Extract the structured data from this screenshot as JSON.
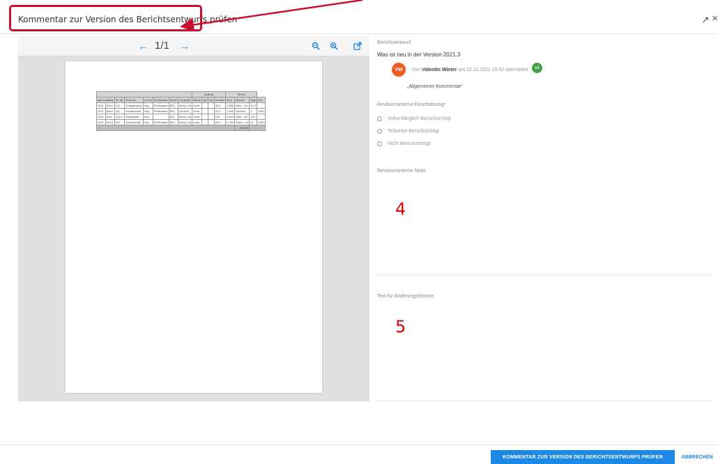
{
  "dialog": {
    "title": "Kommentar zur Version des Berichtsentwurfs prüfen",
    "expand_icon": "↗",
    "close_icon": "×"
  },
  "annotation": {
    "color": "#c8102e"
  },
  "viewer": {
    "prev_icon": "←",
    "next_icon": "→",
    "page_indicator": "1/1",
    "zoom_out_icon": "zoom-out",
    "zoom_in_icon": "zoom-in",
    "open_external_icon": "open-external"
  },
  "document_table": {
    "group_row": [
      "",
      "",
      "",
      "",
      "",
      "",
      "",
      "",
      "Auftrag",
      "",
      "",
      "",
      "",
      "",
      "Termin",
      "",
      ""
    ],
    "headers": [
      "egensufgabe",
      "Prf.-Nr.",
      "Prüfung",
      "g.-Einf",
      "fungskateg",
      "Kürzel",
      "Zungselb",
      "Monat",
      "Von",
      "Bis",
      "sevorgs",
      "Kern",
      "Revisor",
      "Tage",
      "Jahr"
    ],
    "rows": [
      [
        "2021",
        "Einla",
        "102",
        "Einlagengesc",
        "Org.-",
        "Prüfungska",
        "DE1.",
        "Bruss, Ho",
        "Unde",
        "",
        "",
        "40,5",
        "2,600",
        "Henn, Chr",
        "40,5",
        ""
      ],
      [
        "2021",
        "Kund",
        "101",
        "Kundenkredi",
        "Org.-",
        "Prüfungska",
        "DE1.",
        "Gerlach,",
        "Unde",
        "",
        "",
        "22,5",
        "1,000",
        "Gerlach,",
        "1",
        "2021"
      ],
      [
        "2021",
        "Riski",
        "101.6",
        "Risikokapit",
        "Org.-",
        "",
        "DE1.",
        "Bruss, Ho",
        "Unde",
        "",
        "",
        "100",
        "0,000",
        "Henn, Chr",
        "100",
        ""
      ],
      [
        "2021",
        "Kund",
        "101",
        "Kundenkredi",
        "Org.-",
        "Prüfungska",
        "DE1.",
        "Bruss, Ho",
        "Unde",
        "",
        "",
        "44,5",
        "3,300",
        "Steck, Chr",
        "22",
        "2021"
      ]
    ],
    "total": "10,500"
  },
  "right_panel": {
    "draft_label": "Berichtsentwurf",
    "draft_value": "Was ist neu in der Version 2021.3",
    "avatar_initials": "VW",
    "meta_prefix": "Von",
    "author": "Valentin Winter",
    "meta_suffix": "am 22.11.2021 10:42 übermittelt",
    "version_badge": "v1",
    "comment": "„Allgemeiner Kommentar“",
    "assessment_label": "Revisionsinterne Einschätzung*",
    "options": [
      "Vollumfänglich Berücksichtigt",
      "Teilweise Berücksichtigt",
      "Nicht Berücksichtigt"
    ],
    "note_label": "Revisionsinterne Notiz",
    "history_label": "Text für Änderungshistorie",
    "marker_4": "4",
    "marker_5": "5"
  },
  "footer": {
    "primary_button": "KOMMENTAR ZUR VERSION DES BERICHTSENTWURFS PRÜFEN",
    "secondary_button": "ABBRECHEN"
  },
  "colors": {
    "accent": "#1e88e5",
    "avatar": "#ef5a24",
    "badge": "#43a047",
    "marker": "#e00000"
  }
}
